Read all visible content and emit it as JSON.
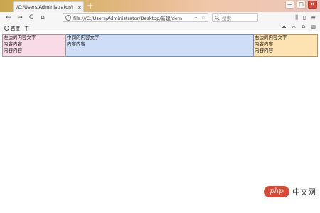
{
  "browser": {
    "tab": {
      "title": "/C:/Users/Administrator/Deskto",
      "close": "×"
    },
    "new_tab": "+",
    "window_controls": [
      "—",
      "□",
      "✕"
    ],
    "nav": {
      "back": "←",
      "forward": "→",
      "reload": "C",
      "home": "⌂"
    },
    "url": "file:///C:/Users/Administrator/Desktop/新建/dem",
    "url_menu": "···",
    "bookmark_star": "☆",
    "search_placeholder": "搜索",
    "toolbar_icons": [
      "library-icon",
      "sidebar-icon",
      "menu-icon"
    ],
    "bookmark": "百度一下",
    "bookmark_tools": [
      "extension-icon",
      "scissors-icon",
      "copy-icon",
      "trash-icon"
    ]
  },
  "page": {
    "left": {
      "title": "左边的内容文字",
      "line1": "内容内容",
      "line2": "内容内容"
    },
    "middle": {
      "title": "中间的内容文字",
      "line1": "内容内容"
    },
    "right": {
      "title": "右边的内容文字",
      "line1": "内容内容",
      "line2": "内容内容"
    }
  },
  "colors": {
    "left": "#f9dbe8",
    "middle": "#cfdef6",
    "right": "#fde3b1"
  },
  "watermark": {
    "logo": "php",
    "text": "中文网"
  }
}
